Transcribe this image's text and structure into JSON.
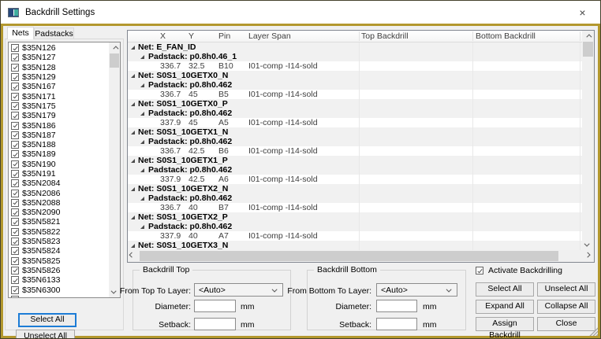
{
  "window": {
    "title": "Backdrill Settings",
    "close_glyph": "×"
  },
  "colors": {
    "frame_accent": "#b3982e",
    "focus_blue": "#1c7cd6",
    "row_stripe": "#f1f1f1"
  },
  "left_panel": {
    "tabs": [
      {
        "label": "Nets",
        "active": true
      },
      {
        "label": "Padstacks",
        "active": false
      }
    ],
    "nets": [
      "$35N126",
      "$35N127",
      "$35N128",
      "$35N129",
      "$35N167",
      "$35N171",
      "$35N175",
      "$35N179",
      "$35N186",
      "$35N187",
      "$35N188",
      "$35N189",
      "$35N190",
      "$35N191",
      "$35N2084",
      "$35N2086",
      "$35N2088",
      "$35N2090",
      "$35N5821",
      "$35N5822",
      "$35N5823",
      "$35N5824",
      "$35N5825",
      "$35N5826",
      "$35N6133",
      "$35N6300"
    ],
    "all_checked": true,
    "select_all_label": "Select All",
    "unselect_all_label": "Unselect All"
  },
  "table": {
    "columns": [
      "X",
      "Y",
      "Pin",
      "Layer Span",
      "Top Backdrill",
      "Bottom Backdrill"
    ],
    "net_prefix": "Net: ",
    "padstack_prefix": "Padstack: ",
    "groups": [
      {
        "net": "E_FAN_ID",
        "padstack": "p0.8h0.46_1",
        "pins": [
          {
            "x": "336.7",
            "y": "32.5",
            "pin": "B10",
            "span": "I01-comp -I14-sold",
            "top_backdrill": "",
            "bottom_backdrill": ""
          }
        ]
      },
      {
        "net": "S0S1_10GETX0_N",
        "padstack": "p0.8h0.462",
        "pins": [
          {
            "x": "336.7",
            "y": "45",
            "pin": "B5",
            "span": "I01-comp -I14-sold",
            "top_backdrill": "",
            "bottom_backdrill": ""
          }
        ]
      },
      {
        "net": "S0S1_10GETX0_P",
        "padstack": "p0.8h0.462",
        "pins": [
          {
            "x": "337.9",
            "y": "45",
            "pin": "A5",
            "span": "I01-comp -I14-sold",
            "top_backdrill": "",
            "bottom_backdrill": ""
          }
        ]
      },
      {
        "net": "S0S1_10GETX1_N",
        "padstack": "p0.8h0.462",
        "pins": [
          {
            "x": "336.7",
            "y": "42.5",
            "pin": "B6",
            "span": "I01-comp -I14-sold",
            "top_backdrill": "",
            "bottom_backdrill": ""
          }
        ]
      },
      {
        "net": "S0S1_10GETX1_P",
        "padstack": "p0.8h0.462",
        "pins": [
          {
            "x": "337.9",
            "y": "42.5",
            "pin": "A6",
            "span": "I01-comp -I14-sold",
            "top_backdrill": "",
            "bottom_backdrill": ""
          }
        ]
      },
      {
        "net": "S0S1_10GETX2_N",
        "padstack": "p0.8h0.462",
        "pins": [
          {
            "x": "336.7",
            "y": "40",
            "pin": "B7",
            "span": "I01-comp -I14-sold",
            "top_backdrill": "",
            "bottom_backdrill": ""
          }
        ]
      },
      {
        "net": "S0S1_10GETX2_P",
        "padstack": "p0.8h0.462",
        "pins": [
          {
            "x": "337.9",
            "y": "40",
            "pin": "A7",
            "span": "I01-comp -I14-sold",
            "top_backdrill": "",
            "bottom_backdrill": ""
          }
        ]
      },
      {
        "net": "S0S1_10GETX3_N"
      }
    ]
  },
  "backdrill_top": {
    "title": "Backdrill Top",
    "layer_label": "From Top To Layer:",
    "layer_value": "<Auto>",
    "diameter_label": "Diameter:",
    "diameter_value": "",
    "setback_label": "Setback:",
    "setback_value": "",
    "unit": "mm"
  },
  "backdrill_bottom": {
    "title": "Backdrill Bottom",
    "layer_label": "From Bottom To Layer:",
    "layer_value": "<Auto>",
    "diameter_label": "Diameter:",
    "diameter_value": "",
    "setback_label": "Setback:",
    "setback_value": "",
    "unit": "mm"
  },
  "actions": {
    "activate_label": "Activate Backdrilling",
    "activate_checked": true,
    "buttons": [
      "Select All",
      "Unselect All",
      "Expand All",
      "Collapse All",
      "Assign Backdrill",
      "Close"
    ]
  }
}
